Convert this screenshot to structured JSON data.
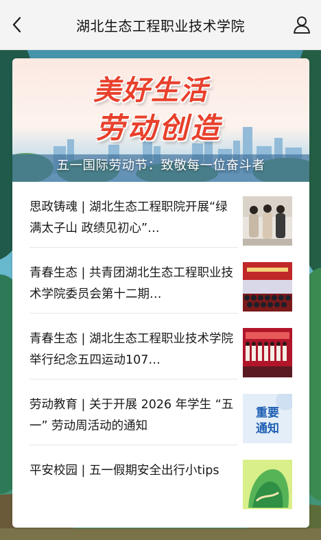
{
  "header": {
    "title": "湖北生态工程职业技术学院"
  },
  "banner": {
    "slogan_line1": "美好生活",
    "slogan_line2": "劳动创造",
    "caption": "五一国际劳动节：致敬每一位奋斗者"
  },
  "news": [
    {
      "title": "思政铸魂 | 湖北生态工程职院开展“绿满太子山 政绩见初心”…",
      "thumb": "photo-students-standing"
    },
    {
      "title": "青春生态 | 共青团湖北生态工程职业技术学院委员会第十二期…",
      "thumb": "photo-assembly-hall"
    },
    {
      "title": "青春生态 | 湖北生态工程职业技术学院举行纪念五四运动107…",
      "thumb": "photo-stage-performance"
    },
    {
      "title": "劳动教育 | 关于开展 2026 年学生 “五一” 劳动周活动的通知",
      "thumb": "notice-graphic",
      "thumb_text_1": "重要",
      "thumb_text_2": "通知"
    },
    {
      "title": "平安校园 |  五一假期安全出行小tips",
      "thumb": "green-landscape-graphic"
    }
  ],
  "colors": {
    "slogan": "#e8402c",
    "notice_text": "#1e5fb3",
    "topbar": "#f4f4f4"
  }
}
